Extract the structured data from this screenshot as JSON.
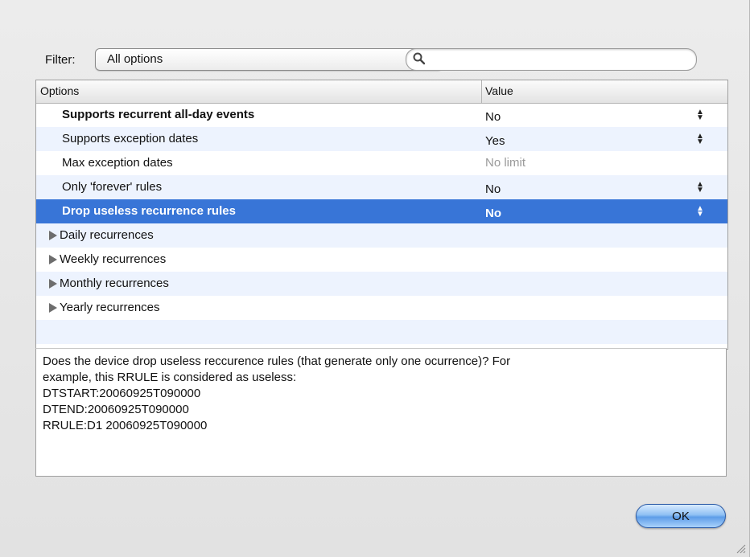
{
  "filter": {
    "label": "Filter:",
    "selected": "All options",
    "search_value": "",
    "search_placeholder": ""
  },
  "table": {
    "headers": {
      "options": "Options",
      "value": "Value"
    },
    "rows": [
      {
        "label": "Supports recurrent all-day events",
        "value": "No",
        "bold": true,
        "stepper": true
      },
      {
        "label": "Supports exception dates",
        "value": "Yes",
        "stepper": true
      },
      {
        "label": "Max exception dates",
        "value": "No limit",
        "muted": true
      },
      {
        "label": "Only 'forever' rules",
        "value": "No",
        "stepper": true
      },
      {
        "label": "Drop useless recurrence rules",
        "value": "No",
        "stepper": true,
        "selected": true
      }
    ],
    "groups": [
      {
        "label": "Daily recurrences"
      },
      {
        "label": "Weekly recurrences"
      },
      {
        "label": "Monthly recurrences"
      },
      {
        "label": "Yearly recurrences"
      }
    ]
  },
  "description": {
    "line1": "Does the device drop useless reccurence rules (that generate only one ocurrence)? For",
    "line2": "example, this RRULE is considered as useless:",
    "line3": "DTSTART:20060925T090000",
    "line4": "DTEND:20060925T090000",
    "line5": "RRULE:D1 20060925T090000"
  },
  "buttons": {
    "ok": "OK"
  },
  "colors": {
    "selection": "#3875d7",
    "alt_row": "#edf3fe"
  }
}
